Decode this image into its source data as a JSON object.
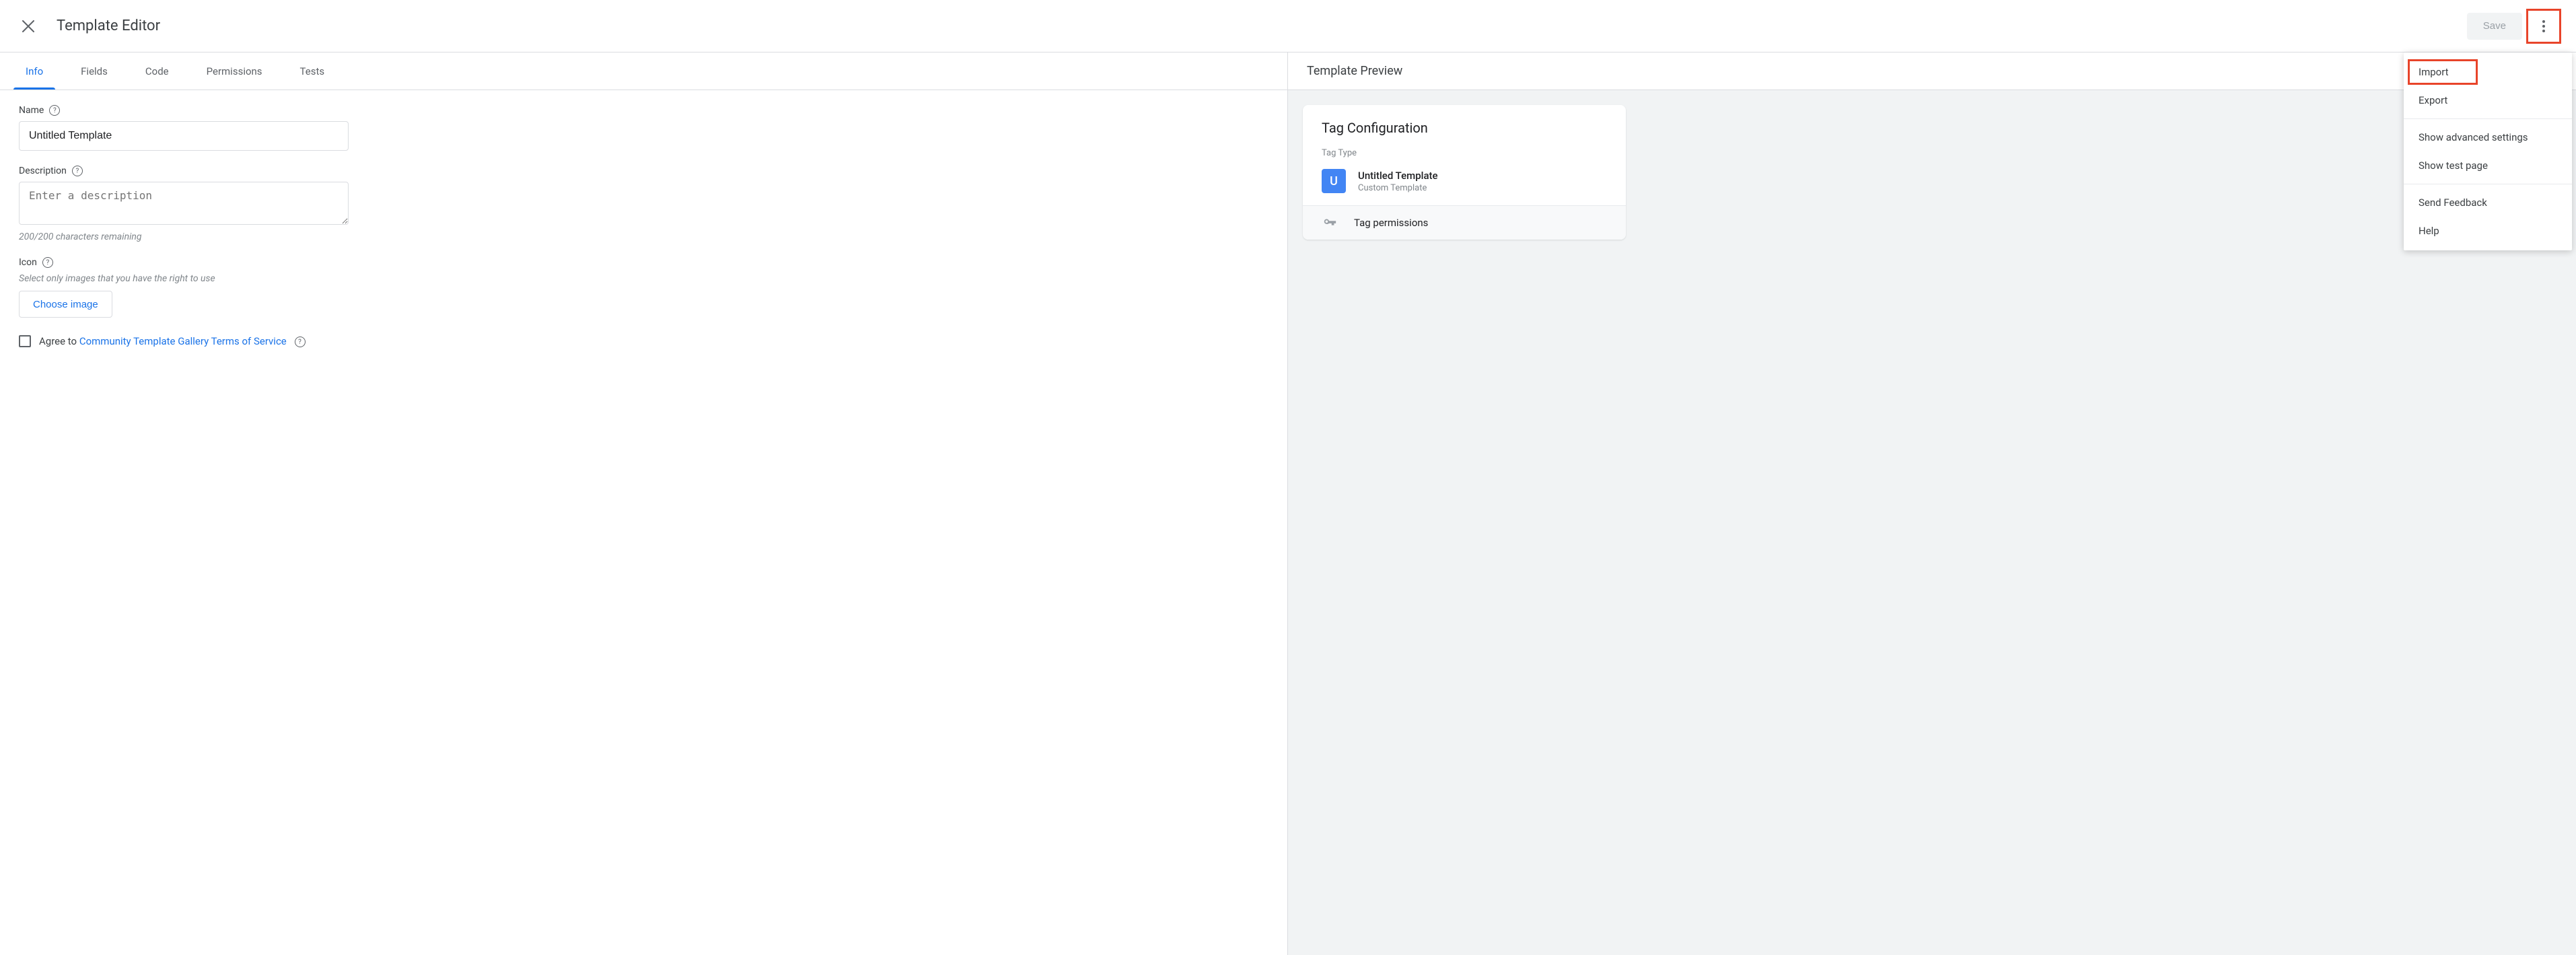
{
  "header": {
    "title": "Template Editor",
    "save_label": "Save"
  },
  "tabs": [
    "Info",
    "Fields",
    "Code",
    "Permissions",
    "Tests"
  ],
  "active_tab_index": 0,
  "form": {
    "name_label": "Name",
    "name_value": "Untitled Template",
    "desc_label": "Description",
    "desc_placeholder": "Enter a description",
    "desc_helper": "200/200 characters remaining",
    "icon_label": "Icon",
    "icon_helper": "Select only images that you have the right to use",
    "choose_image": "Choose image",
    "agree_prefix": "Agree to ",
    "agree_link": "Community Template Gallery Terms of Service"
  },
  "preview": {
    "header": "Template Preview",
    "card_title": "Tag Configuration",
    "tag_type_label": "Tag Type",
    "badge_letter": "U",
    "tag_name": "Untitled Template",
    "tag_sub": "Custom Template",
    "permissions": "Tag permissions"
  },
  "menu": {
    "import": "Import",
    "export": "Export",
    "advanced": "Show advanced settings",
    "test_page": "Show test page",
    "feedback": "Send Feedback",
    "help": "Help"
  }
}
